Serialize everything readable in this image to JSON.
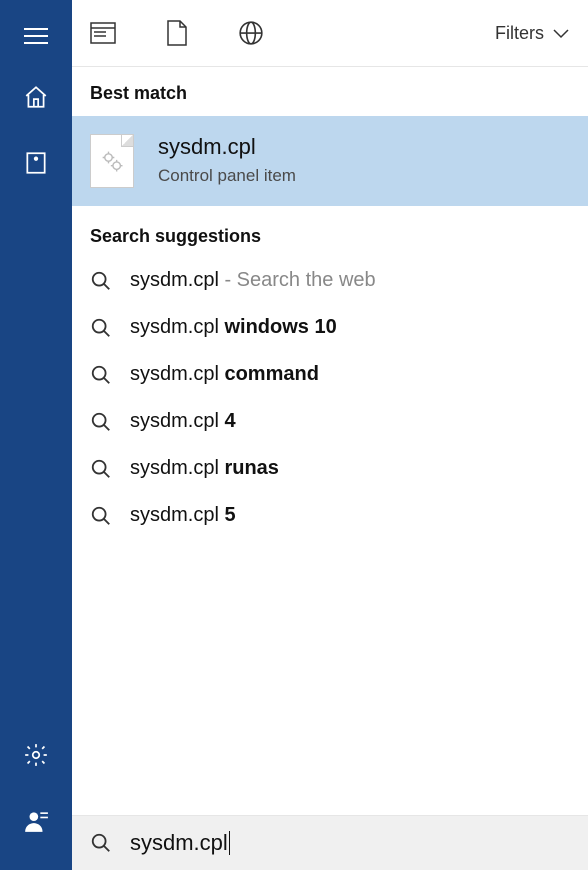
{
  "colors": {
    "sidebar_bg": "#194584",
    "highlight_bg": "#bdd7ee"
  },
  "tabs": {
    "filters_label": "Filters"
  },
  "best_match": {
    "header": "Best match",
    "title": "sysdm.cpl",
    "subtitle": "Control panel item"
  },
  "suggestions": {
    "header": "Search suggestions",
    "items": [
      {
        "prefix": "sysdm.cpl",
        "bold": "",
        "trail": " - Search the web"
      },
      {
        "prefix": "sysdm.cpl ",
        "bold": "windows 10",
        "trail": ""
      },
      {
        "prefix": "sysdm.cpl ",
        "bold": "command",
        "trail": ""
      },
      {
        "prefix": "sysdm.cpl ",
        "bold": "4",
        "trail": ""
      },
      {
        "prefix": "sysdm.cpl ",
        "bold": "runas",
        "trail": ""
      },
      {
        "prefix": "sysdm.cpl ",
        "bold": "5",
        "trail": ""
      }
    ]
  },
  "search": {
    "value": "sysdm.cpl"
  }
}
